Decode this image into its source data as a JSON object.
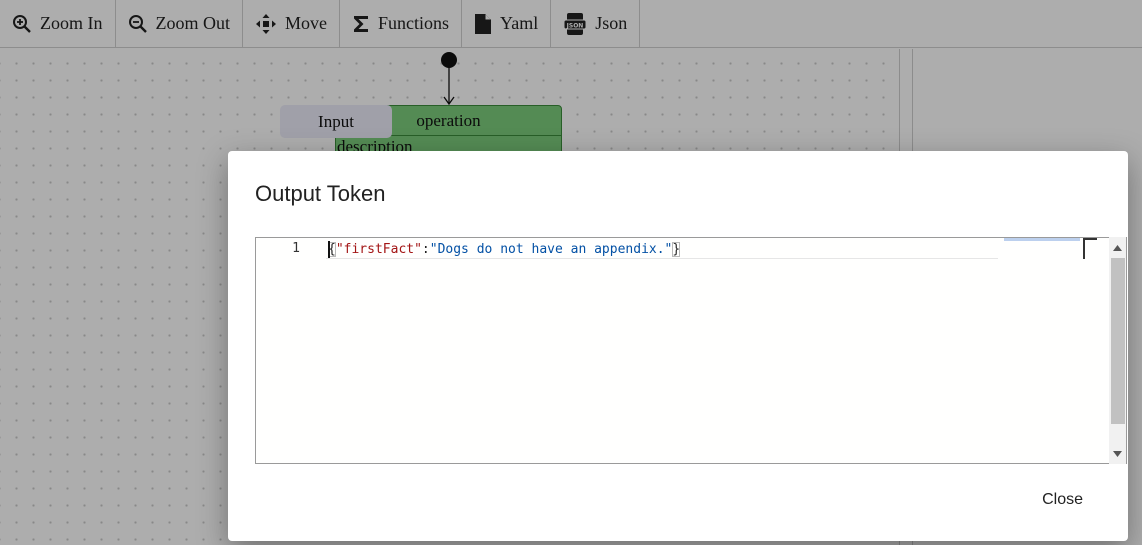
{
  "toolbar": {
    "items": [
      {
        "label": "Zoom In",
        "icon": "zoom-in-icon"
      },
      {
        "label": "Zoom Out",
        "icon": "zoom-out-icon"
      },
      {
        "label": "Move",
        "icon": "move-icon"
      },
      {
        "label": "Functions",
        "icon": "sigma-icon"
      },
      {
        "label": "Yaml",
        "icon": "file-icon"
      },
      {
        "label": "Json",
        "icon": "json-file-icon"
      }
    ]
  },
  "canvas": {
    "node": {
      "title": "operation",
      "description": "description",
      "input_label": "Input",
      "color": "#7ccd7c"
    }
  },
  "modal": {
    "title": "Output Token",
    "editor": {
      "line_number": "1",
      "tokens": {
        "open_brace": "{",
        "key": "\"firstFact\"",
        "colon": ":",
        "value": "\"Dogs do not have an appendix.\"",
        "close_brace": "}"
      }
    },
    "close_label": "Close"
  },
  "colors": {
    "json_key": "#a31515",
    "json_string": "#0451a5",
    "overlay": "rgba(0,0,0,0.32)"
  }
}
